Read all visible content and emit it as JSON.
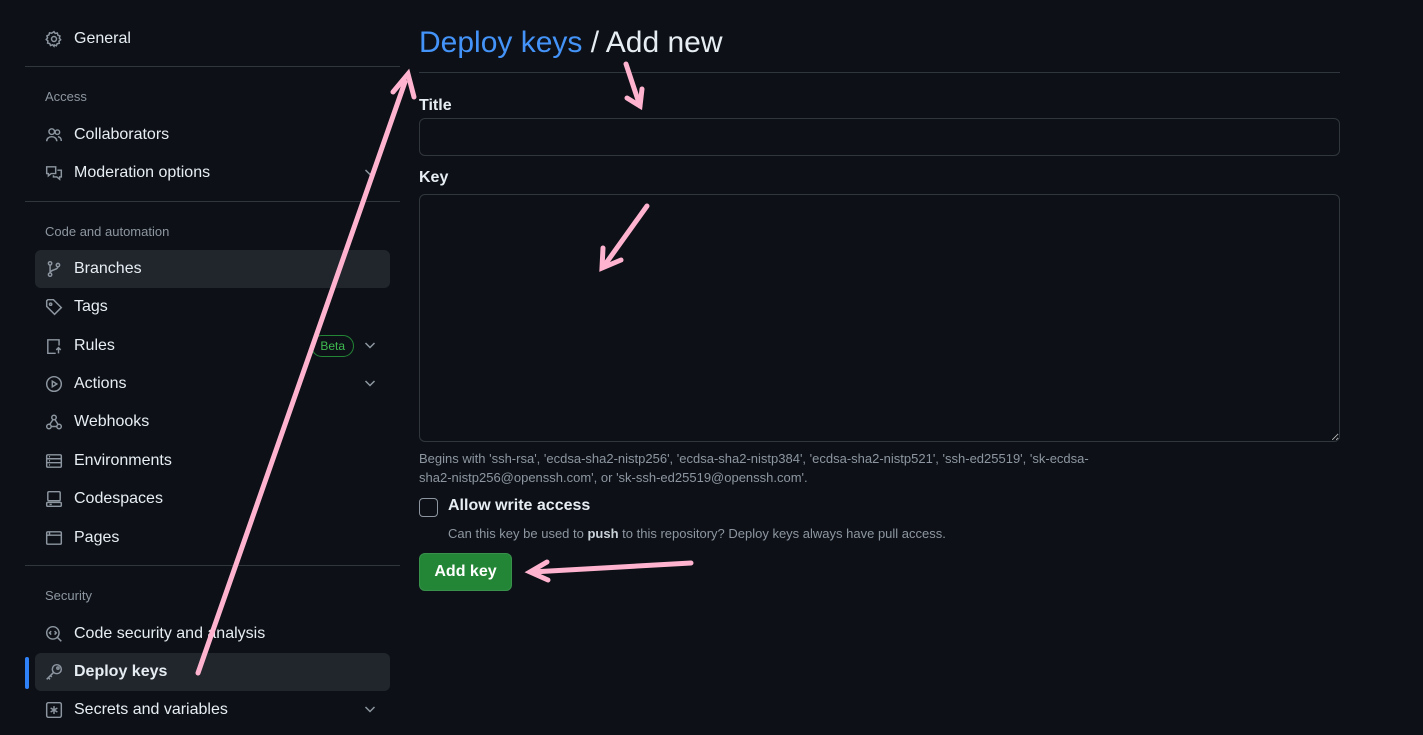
{
  "sidebar": {
    "general": "General",
    "sections": {
      "access": "Access",
      "code_automation": "Code and automation",
      "security": "Security"
    },
    "items": {
      "collaborators": "Collaborators",
      "moderation": "Moderation options",
      "branches": "Branches",
      "tags": "Tags",
      "rules": "Rules",
      "rules_badge": "Beta",
      "actions": "Actions",
      "webhooks": "Webhooks",
      "environments": "Environments",
      "codespaces": "Codespaces",
      "pages": "Pages",
      "code_security": "Code security and analysis",
      "deploy_keys": "Deploy keys",
      "secrets": "Secrets and variables"
    }
  },
  "main": {
    "breadcrumb_link": "Deploy keys",
    "breadcrumb_sep": " / ",
    "breadcrumb_current": "Add new",
    "title_label": "Title",
    "title_value": "",
    "key_label": "Key",
    "key_value": "",
    "key_help": "Begins with 'ssh-rsa', 'ecdsa-sha2-nistp256', 'ecdsa-sha2-nistp384', 'ecdsa-sha2-nistp521', 'ssh-ed25519', 'sk-ecdsa-sha2-nistp256@openssh.com', or 'sk-ssh-ed25519@openssh.com'.",
    "write_access_label": "Allow write access",
    "write_access_note_before": "Can this key be used to ",
    "write_access_note_bold": "push",
    "write_access_note_after": " to this repository? Deploy keys always have pull access.",
    "add_key_button": "Add key"
  },
  "colors": {
    "background": "#0d1117",
    "accent_link": "#4493f8",
    "button_green": "#238636",
    "annotation_pink": "#ffb3cf"
  }
}
